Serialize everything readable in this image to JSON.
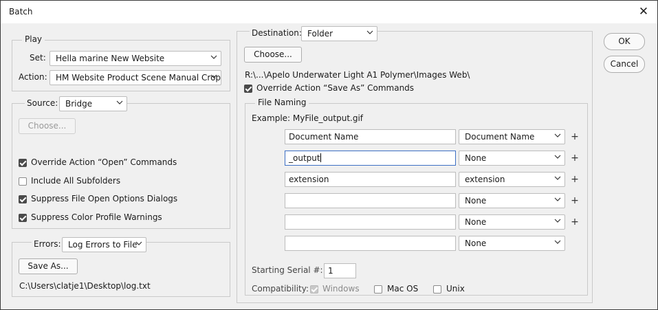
{
  "window": {
    "title": "Batch",
    "close_glyph": "✕"
  },
  "play": {
    "legend": "Play",
    "set_label": "Set:",
    "set_value": "Hella marine New Website",
    "action_label": "Action:",
    "action_value": "HM Website Product Scene Manual Crop"
  },
  "source": {
    "label": "Source:",
    "value": "Bridge",
    "choose_label": "Choose...",
    "options": [
      {
        "label": "Override Action “Open” Commands",
        "checked": true
      },
      {
        "label": "Include All Subfolders",
        "checked": false
      },
      {
        "label": "Suppress File Open Options Dialogs",
        "checked": true
      },
      {
        "label": "Suppress Color Profile Warnings",
        "checked": true
      }
    ]
  },
  "errors": {
    "label": "Errors:",
    "value": "Log Errors to File",
    "save_as_label": "Save As...",
    "path": "C:\\Users\\clatje1\\Desktop\\log.txt"
  },
  "destination": {
    "label": "Destination:",
    "value": "Folder",
    "choose_label": "Choose...",
    "path": "R:\\...\\Apelo Underwater Light A1 Polymer\\Images Web\\",
    "override_label": "Override Action “Save As” Commands",
    "override_checked": true
  },
  "file_naming": {
    "legend": "File Naming",
    "example": "Example: MyFile_output.gif",
    "rows": [
      {
        "text": "Document Name",
        "select": "Document Name",
        "plus": "+"
      },
      {
        "text": "_output",
        "select": "None",
        "plus": "+"
      },
      {
        "text": "extension",
        "select": "extension",
        "plus": "+"
      },
      {
        "text": "",
        "select": "None",
        "plus": "+"
      },
      {
        "text": "",
        "select": "None",
        "plus": "+"
      },
      {
        "text": "",
        "select": "None",
        "plus": ""
      }
    ],
    "serial_label": "Starting Serial #:",
    "serial_value": "1",
    "compat_label": "Compatibility:",
    "compat": [
      {
        "label": "Windows",
        "checked": true,
        "disabled": true
      },
      {
        "label": "Mac OS",
        "checked": false,
        "disabled": false
      },
      {
        "label": "Unix",
        "checked": false,
        "disabled": false
      }
    ]
  },
  "buttons": {
    "ok": "OK",
    "cancel": "Cancel"
  }
}
